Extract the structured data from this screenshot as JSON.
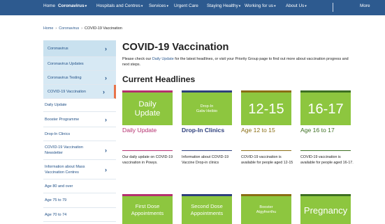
{
  "topnav": {
    "items": [
      {
        "label": "Home",
        "caret": ""
      },
      {
        "label": "Coronavirus",
        "caret": "▾"
      },
      {
        "label": "Hospitals and Centres",
        "caret": "▾"
      },
      {
        "label": "Services",
        "caret": "▾"
      },
      {
        "label": "Urgent Care",
        "caret": ""
      },
      {
        "label": "Staying Healthy",
        "caret": "▾"
      },
      {
        "label": "Working for us",
        "caret": "▾"
      },
      {
        "label": "About Us",
        "caret": "▾"
      },
      {
        "label": "More",
        "caret": ""
      }
    ],
    "color": "#2d5a8f"
  },
  "breadcrumb": {
    "home": "Home",
    "sep1": "›",
    "section": "Coronavirus",
    "sep2": "›",
    "current": "COVID-19 Vaccination"
  },
  "sidebar": {
    "items": [
      {
        "label": "Coronavirus",
        "chevron": "›"
      },
      {
        "label": "Coronavirus Updates",
        "chevron": ""
      },
      {
        "label": "Coronavirus Testing",
        "chevron": "›"
      },
      {
        "label": "COVID-19 Vaccination",
        "chevron": "›"
      },
      {
        "label": "Daily Update",
        "chevron": ""
      },
      {
        "label": "Booster Programme",
        "chevron": "›"
      },
      {
        "label": "Drop-In Clinics",
        "chevron": ""
      },
      {
        "label": "COVID-19 Vaccination Newsletter",
        "chevron": "›"
      },
      {
        "label": "Information about Mass Vaccination Centres",
        "chevron": "›"
      },
      {
        "label": "Age 80 and over",
        "chevron": ""
      },
      {
        "label": "Age 75 to 79",
        "chevron": ""
      },
      {
        "label": "Age 70 to 74",
        "chevron": ""
      }
    ],
    "accent": "#e8734a"
  },
  "main": {
    "title": "COVID-19 Vaccination",
    "intro_before": "Please check our ",
    "intro_link": "Daily Update",
    "intro_after": " for the latest headlines, or visit your Priority Group page to find out more about vaccination progress and next steps.",
    "headlines_title": "Current Headlines"
  },
  "cards": [
    {
      "tile_line1": "Daily",
      "tile_line2": "Update",
      "heading": "Daily Update",
      "desc": "Our daily update on COVID-19 vaccination in Powys.",
      "accent": "#b5306f"
    },
    {
      "tile_line1": "Drop-In",
      "tile_line2": "Galw Heibio",
      "heading": "Drop-In Clinics",
      "desc": "Information about COVID-19 Vaccine Drop-in clinics",
      "accent": "#2d3f7c"
    },
    {
      "tile_line1": "12-15",
      "tile_line2": "",
      "heading": "Age 12 to 15",
      "desc": "COVID-19 vaccination is available for people aged 12-15",
      "accent": "#8a6d14"
    },
    {
      "tile_line1": "16-17",
      "tile_line2": "",
      "heading": "Age 16 to 17",
      "desc": "COVID-19 vaccination is available for people aged 16-17.",
      "accent": "#3d6f22"
    }
  ],
  "cards_row2": [
    {
      "tile_line1": "First Dose",
      "tile_line2": "Appointments",
      "accent": "#b5306f"
    },
    {
      "tile_line1": "Second Dose",
      "tile_line2": "Appointments",
      "accent": "#2d3f7c"
    },
    {
      "tile_line1": "Booster",
      "tile_line2": "Atgyfnerthu",
      "accent": "#8a6d14"
    },
    {
      "tile_line1": "Pregnancy",
      "tile_line2": "",
      "accent": "#3d6f22"
    }
  ]
}
